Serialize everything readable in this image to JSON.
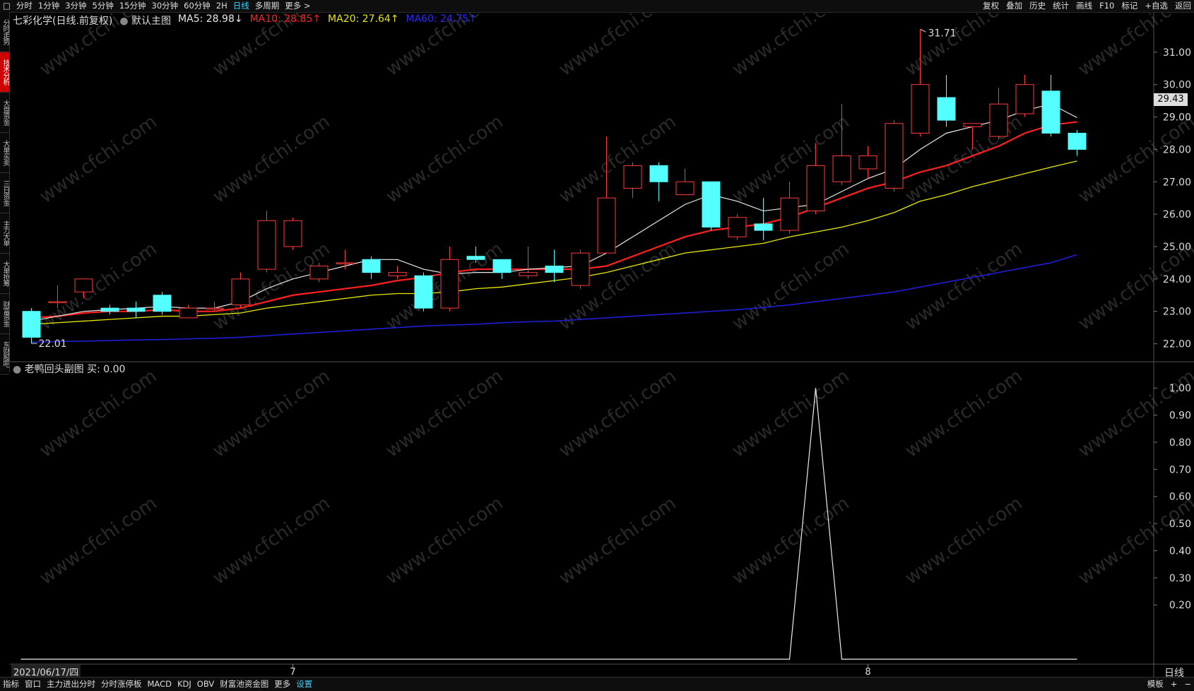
{
  "topbar": {
    "left": [
      {
        "label": "□",
        "name": "layout-toggle"
      },
      {
        "label": "分时",
        "name": "tab-fenshi"
      },
      {
        "label": "1分钟",
        "name": "tab-1min"
      },
      {
        "label": "3分钟",
        "name": "tab-3min"
      },
      {
        "label": "5分钟",
        "name": "tab-5min"
      },
      {
        "label": "15分钟",
        "name": "tab-15min"
      },
      {
        "label": "30分钟",
        "name": "tab-30min"
      },
      {
        "label": "60分钟",
        "name": "tab-60min"
      },
      {
        "label": "2H",
        "name": "tab-2h"
      },
      {
        "label": "日线",
        "name": "tab-daily",
        "active": true
      },
      {
        "label": "多周期",
        "name": "tab-multi"
      },
      {
        "label": "更多 >",
        "name": "tab-more"
      }
    ],
    "right": [
      {
        "label": "复权",
        "name": "btn-adjust"
      },
      {
        "label": "叠加",
        "name": "btn-overlay"
      },
      {
        "label": "历史",
        "name": "btn-history"
      },
      {
        "label": "统计",
        "name": "btn-stats"
      },
      {
        "label": "画线",
        "name": "btn-draw"
      },
      {
        "label": "F10",
        "name": "btn-f10"
      },
      {
        "label": "标记",
        "name": "btn-mark"
      },
      {
        "label": "+自选",
        "name": "btn-add-watch"
      },
      {
        "label": "返回",
        "name": "btn-back"
      }
    ]
  },
  "sidebar": [
    "分时走势",
    "技术分析",
    "大盘资金",
    "大单买卖",
    "三日资金",
    "主力大单",
    "大单抢筹",
    "财富资金",
    "东财股吧"
  ],
  "legend": {
    "title": "七彩化学(日线.前复权)",
    "main": "默认主图",
    "ma5": "MA5: 28.98↓",
    "ma10": "MA10: 28.85↑",
    "ma20": "MA20: 27.64↑",
    "ma60": "MA60: 24.75↑"
  },
  "sublegend": "老鸭回头副图  买: 0.00",
  "price_tag": "29.43",
  "date_box": "2021/06/17/四",
  "period_label": "日线",
  "bottombar": {
    "left": [
      {
        "label": "指标",
        "name": "btn-indicator"
      },
      {
        "label": "窗口",
        "name": "btn-window"
      },
      {
        "label": "主力进出分时",
        "name": "btn-main-flow"
      },
      {
        "label": "分时涨停板",
        "name": "btn-limit-up"
      },
      {
        "label": "MACD",
        "name": "btn-macd"
      },
      {
        "label": "KDJ",
        "name": "btn-kdj"
      },
      {
        "label": "OBV",
        "name": "btn-obv"
      },
      {
        "label": "财富池资金图",
        "name": "btn-wealth-pool"
      },
      {
        "label": "更多",
        "name": "btn-more"
      },
      {
        "label": "设置",
        "name": "btn-settings",
        "active": true
      }
    ],
    "right": [
      {
        "label": "模板",
        "name": "btn-template"
      },
      {
        "label": "+",
        "name": "btn-zoom-in"
      },
      {
        "label": "−",
        "name": "btn-zoom-out"
      }
    ]
  },
  "colors": {
    "up": "#ff3b3b",
    "down": "#54ffff",
    "ma5": "#e8e8e8",
    "ma10": "#ff2020",
    "ma20": "#e8e800",
    "ma60": "#2020e0",
    "watermark": "#2a2a2a"
  },
  "watermark": "www.cfchi.com",
  "chart_data": {
    "type": "candlestick",
    "price_axis": {
      "ticks": [
        "31.00",
        "30.00",
        "29.00",
        "28.00",
        "27.00",
        "26.00",
        "25.00",
        "24.00",
        "23.00",
        "22.00"
      ],
      "ylim": [
        21.8,
        32.0
      ]
    },
    "sub_axis": {
      "ticks": [
        "1.00",
        "0.90",
        "0.80",
        "0.70",
        "0.60",
        "0.50",
        "0.40",
        "0.30",
        "0.20"
      ],
      "ylim": [
        0,
        1.05
      ]
    },
    "x_labels": [
      {
        "index": 10,
        "label": "7"
      },
      {
        "index": 32,
        "label": "8"
      }
    ],
    "annotations": {
      "high": "31.71",
      "low": "22.01"
    },
    "candles": [
      [
        23.0,
        22.2,
        23.1,
        22.01
      ],
      [
        23.3,
        23.3,
        23.8,
        23.1
      ],
      [
        23.6,
        24.0,
        24.0,
        23.4
      ],
      [
        23.1,
        23.0,
        23.2,
        22.9
      ],
      [
        23.1,
        23.0,
        23.3,
        22.8
      ],
      [
        23.5,
        23.0,
        23.6,
        22.9
      ],
      [
        22.8,
        23.1,
        23.2,
        22.8
      ],
      [
        23.1,
        23.1,
        23.3,
        23.0
      ],
      [
        23.2,
        24.0,
        24.2,
        23.1
      ],
      [
        24.3,
        25.8,
        26.1,
        24.2
      ],
      [
        25.0,
        25.8,
        25.9,
        24.9
      ],
      [
        24.0,
        24.4,
        24.5,
        23.9
      ],
      [
        24.5,
        24.5,
        24.9,
        24.3
      ],
      [
        24.6,
        24.2,
        24.7,
        24.0
      ],
      [
        24.1,
        24.2,
        24.4,
        24.0
      ],
      [
        24.1,
        23.1,
        24.2,
        23.0
      ],
      [
        23.1,
        24.6,
        25.0,
        23.0
      ],
      [
        24.7,
        24.6,
        25.0,
        24.5
      ],
      [
        24.6,
        24.2,
        24.6,
        24.0
      ],
      [
        24.1,
        24.2,
        25.0,
        24.0
      ],
      [
        24.4,
        24.2,
        24.9,
        23.9
      ],
      [
        23.8,
        24.8,
        24.9,
        23.7
      ],
      [
        24.8,
        26.5,
        28.4,
        24.8
      ],
      [
        26.8,
        27.5,
        27.6,
        26.5
      ],
      [
        27.5,
        27.0,
        27.6,
        26.4
      ],
      [
        26.6,
        27.0,
        27.4,
        26.6
      ],
      [
        27.0,
        25.6,
        27.0,
        25.5
      ],
      [
        25.3,
        25.9,
        26.0,
        25.2
      ],
      [
        25.7,
        25.5,
        26.5,
        25.2
      ],
      [
        25.5,
        26.5,
        27.0,
        25.4
      ],
      [
        26.1,
        27.5,
        28.2,
        26.0
      ],
      [
        27.0,
        27.8,
        29.4,
        26.9
      ],
      [
        27.4,
        27.8,
        28.1,
        27.1
      ],
      [
        26.8,
        28.8,
        28.9,
        26.7
      ],
      [
        28.5,
        30.0,
        31.71,
        28.4
      ],
      [
        29.6,
        28.9,
        30.3,
        28.7
      ],
      [
        28.7,
        28.8,
        28.8,
        28.0
      ],
      [
        28.4,
        29.4,
        29.9,
        28.3
      ],
      [
        29.1,
        30.0,
        30.3,
        29.0
      ],
      [
        29.8,
        28.5,
        30.3,
        28.4
      ],
      [
        28.5,
        28.0,
        28.6,
        27.8
      ]
    ],
    "ma5": [
      22.7,
      22.85,
      23.0,
      23.05,
      23.1,
      23.15,
      23.1,
      23.1,
      23.3,
      23.7,
      24.0,
      24.2,
      24.4,
      24.6,
      24.6,
      24.3,
      24.15,
      24.2,
      24.2,
      24.3,
      24.35,
      24.4,
      24.8,
      25.3,
      25.8,
      26.3,
      26.6,
      26.4,
      26.1,
      26.2,
      26.3,
      26.7,
      27.1,
      27.4,
      28.0,
      28.5,
      28.7,
      28.9,
      29.2,
      29.4,
      28.98
    ],
    "ma10": [
      22.8,
      22.85,
      22.95,
      23.0,
      23.0,
      23.05,
      23.0,
      23.0,
      23.1,
      23.3,
      23.5,
      23.6,
      23.7,
      23.8,
      23.95,
      24.05,
      24.2,
      24.3,
      24.3,
      24.3,
      24.3,
      24.3,
      24.4,
      24.7,
      25.0,
      25.3,
      25.5,
      25.6,
      25.7,
      25.9,
      26.2,
      26.5,
      26.8,
      27.0,
      27.3,
      27.5,
      27.8,
      28.1,
      28.5,
      28.75,
      28.85
    ],
    "ma20": [
      22.6,
      22.65,
      22.7,
      22.75,
      22.8,
      22.85,
      22.85,
      22.9,
      22.95,
      23.1,
      23.2,
      23.3,
      23.4,
      23.5,
      23.55,
      23.55,
      23.6,
      23.7,
      23.75,
      23.85,
      23.95,
      24.05,
      24.2,
      24.4,
      24.6,
      24.8,
      24.9,
      25.0,
      25.1,
      25.3,
      25.45,
      25.6,
      25.8,
      26.05,
      26.4,
      26.6,
      26.85,
      27.05,
      27.25,
      27.45,
      27.64
    ],
    "ma60": [
      22.05,
      22.07,
      22.08,
      22.1,
      22.12,
      22.13,
      22.15,
      22.17,
      22.2,
      22.25,
      22.3,
      22.35,
      22.4,
      22.45,
      22.5,
      22.55,
      22.58,
      22.6,
      22.65,
      22.68,
      22.7,
      22.75,
      22.8,
      22.85,
      22.9,
      22.95,
      23.0,
      23.05,
      23.12,
      23.2,
      23.3,
      23.4,
      23.5,
      23.6,
      23.75,
      23.9,
      24.05,
      24.2,
      24.35,
      24.5,
      24.75
    ],
    "sub_values": [
      0,
      0,
      0,
      0,
      0,
      0,
      0,
      0,
      0,
      0,
      0,
      0,
      0,
      0,
      0,
      0,
      0,
      0,
      0,
      0,
      0,
      0,
      0,
      0,
      0,
      0,
      0,
      0,
      0,
      0,
      1.0,
      0,
      0,
      0,
      0,
      0,
      0,
      0,
      0,
      0,
      0
    ]
  }
}
